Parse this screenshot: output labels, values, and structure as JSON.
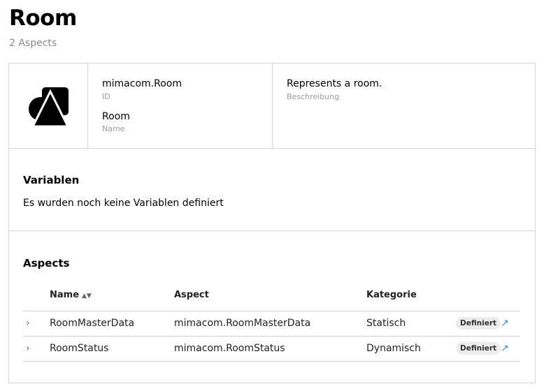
{
  "header": {
    "title": "Room",
    "subtitle": "2 Aspects"
  },
  "info": {
    "logo_icon": "mimacom-shapes-logo",
    "id_value": "mimacom.Room",
    "id_label": "ID",
    "name_value": "Room",
    "name_label": "Name",
    "description_value": "Represents a room.",
    "description_label": "Beschreibung"
  },
  "variables": {
    "title": "Variablen",
    "empty_text": "Es wurden noch keine Variablen definiert"
  },
  "aspects": {
    "title": "Aspects",
    "columns": {
      "name": "Name",
      "aspect": "Aspect",
      "category": "Kategorie"
    },
    "rows": [
      {
        "name": "RoomMasterData",
        "aspect": "mimacom.RoomMasterData",
        "category": "Statisch",
        "status": "Definiert"
      },
      {
        "name": "RoomStatus",
        "aspect": "mimacom.RoomStatus",
        "category": "Dynamisch",
        "status": "Definiert"
      }
    ]
  },
  "colors": {
    "link": "#3b8be8",
    "border": "#d6d6d6",
    "badge_bg": "#ececec"
  }
}
